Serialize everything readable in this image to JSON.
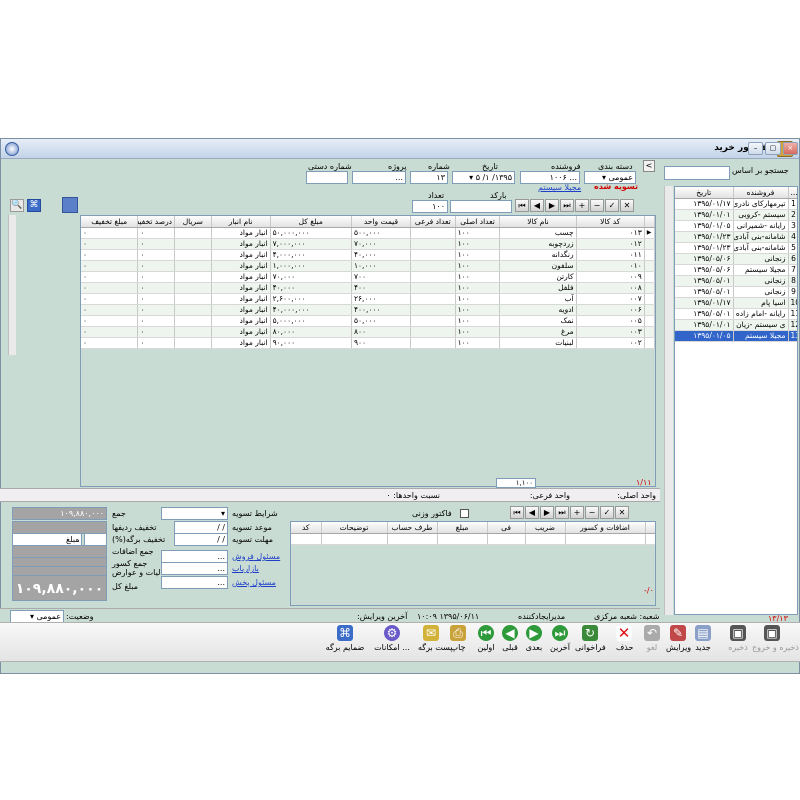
{
  "window": {
    "title": "فاکتور خرید"
  },
  "search": {
    "label": "جستجو بر اساس",
    "value": ""
  },
  "left_list": {
    "headers": [
      "...",
      "فروشنده",
      "تاریخ"
    ],
    "rows": [
      [
        "1",
        "تیرمهارکای نادری",
        "۱۳۹۵/۰۱/۱۷"
      ],
      [
        "2",
        "سیستم -کروبی",
        "۱۳۹۵/۰۱/۰۱"
      ],
      [
        "3",
        "رایانه -شمیرانی",
        "۱۳۹۵/۰۱/۰۵"
      ],
      [
        "4",
        "شامانه-بنی آبادی",
        "۱۳۹۵/۰۱/۲۳"
      ],
      [
        "5",
        "شامانه-بنی آبادی",
        "۱۳۹۵/۰۱/۲۳"
      ],
      [
        "6",
        "زنجانی",
        "۱۳۹۵/۰۵/۰۶"
      ],
      [
        "7",
        "مجیلا سیستم",
        "۱۳۹۵/۰۵/۰۶"
      ],
      [
        "8",
        "زنجانی",
        "۱۳۹۵/۰۵/۰۱"
      ],
      [
        "9",
        "زنجانی",
        "۱۳۹۵/۰۵/۰۱"
      ],
      [
        "10",
        "اسیا پام",
        "۱۳۹۵/۰۱/۱۷"
      ],
      [
        "11",
        "رایانه -امام زاده",
        "۱۳۹۵/۰۵/۰۱"
      ],
      [
        "12",
        "ی سیستم -زیان",
        "۱۳۹۵/۰۱/۰۱"
      ],
      [
        "13",
        "مجیلا سیستم",
        "۱۳۹۵/۰۱/۰۵"
      ]
    ],
    "footer": "۱۳/۱۳"
  },
  "header_fields": {
    "category_label": "دسته بندی",
    "category_value": "عمومی",
    "seller_label": "فروشنده",
    "seller_value": "... ۱۰۰۶",
    "date_label": "تاریخ",
    "date_value": "۱۳۹۵/ ۱/ ۵",
    "number_label": "شماره",
    "number_value": "۱۳",
    "project_label": "پروژه",
    "project_value": "...",
    "manual_label": "شماره دستی",
    "manual_value": "",
    "seller_link": "مجیلا سیستم",
    "settled": "تسویه شده",
    "barcode_label": "بارکد",
    "barcode_value": "",
    "count_label": "تعداد",
    "count_value": "۱۰۰"
  },
  "items_grid": {
    "headers": [
      "کد کالا",
      "نام کالا",
      "تعداد اصلی",
      "تعداد فرعی",
      "قیمت واحد",
      "مبلغ کل",
      "نام انبار",
      "سریال",
      "درصد تخفیف",
      "مبلغ تخفیف"
    ],
    "rows": [
      [
        "۰۱۳",
        "چسب",
        "۱۰۰",
        "",
        "۵۰۰,۰۰۰",
        "۵۰,۰۰۰,۰۰۰",
        "انبار مواد",
        "",
        "۰",
        "۰"
      ],
      [
        "۰۱۲",
        "زردچوبه",
        "۱۰۰",
        "",
        "۷۰,۰۰۰",
        "۷,۰۰۰,۰۰۰",
        "انبار مواد",
        "",
        "۰",
        "۰"
      ],
      [
        "۰۱۱",
        "رنگدانه",
        "۱۰۰",
        "",
        "۴۰,۰۰۰",
        "۴,۰۰۰,۰۰۰",
        "انبار مواد",
        "",
        "۰",
        "۰"
      ],
      [
        "۰۱۰",
        "سلفون",
        "۱۰۰",
        "",
        "۱۰,۰۰۰",
        "۱,۰۰۰,۰۰۰",
        "انبار مواد",
        "",
        "۰",
        "۰"
      ],
      [
        "۰۰۹",
        "کارتن",
        "۱۰۰",
        "",
        "۷۰۰",
        "۷۰,۰۰۰",
        "انبار مواد",
        "",
        "۰",
        "۰"
      ],
      [
        "۰۰۸",
        "فلفل",
        "۱۰۰",
        "",
        "۴۰۰",
        "۴۰,۰۰۰",
        "انبار مواد",
        "",
        "۰",
        "۰"
      ],
      [
        "۰۰۷",
        "آب",
        "۱۰۰",
        "",
        "۲۶,۰۰۰",
        "۲,۶۰۰,۰۰۰",
        "انبار مواد",
        "",
        "۰",
        "۰"
      ],
      [
        "۰۰۶",
        "ادویه",
        "۱۰۰",
        "",
        "۴۰۰,۰۰۰",
        "۴۰,۰۰۰,۰۰۰",
        "انبار مواد",
        "",
        "۰",
        "۰"
      ],
      [
        "۰۰۵",
        "نمک",
        "۱۰۰",
        "",
        "۵۰,۰۰۰",
        "۵,۰۰۰,۰۰۰",
        "انبار مواد",
        "",
        "۰",
        "۰"
      ],
      [
        "۰۰۳",
        "مرغ",
        "۱۰۰",
        "",
        "۸۰۰",
        "۸۰,۰۰۰",
        "انبار مواد",
        "",
        "۰",
        "۰"
      ],
      [
        "۰۰۲",
        "لبنیات",
        "۱۰۰",
        "",
        "۹۰۰",
        "۹۰,۰۰۰",
        "انبار مواد",
        "",
        "۰",
        "۰"
      ]
    ],
    "footer_count": "۱/۱۱",
    "footer_total": "۱,۱۰۰"
  },
  "units": {
    "main": "واحد اصلی:",
    "sub": "واحد فرعی:",
    "ratio": "نسبت واحدها: ۰"
  },
  "totals": {
    "sum_label": "جمع",
    "sum_value": "۱۰۹,۸۸۰,۰۰۰",
    "row_discount_label": "تخفیف ردیفها",
    "row_discount_value": "",
    "sheet_discount_label": "تخفیف برگه(%)",
    "sheet_discount_amount_label": "مبلغ",
    "sheet_discount_value": "۰",
    "additions_label": "جمع اضافات",
    "deductions_label": "جمع کسور",
    "tax_label": "مالیات و عوارض",
    "total_label": "مبلغ کل",
    "total_value": "۱۰۹,۸۸۰,۰۰۰"
  },
  "terms": {
    "settle_label": "شرایط تسویه",
    "due_label": "موعد تسویه",
    "due_value": "/  /",
    "grace_label": "مهلت تسویه",
    "grace_value": "/  /",
    "sales_resp": "مسئول فروش",
    "marketer": "بازاریاب",
    "dist_resp": "مسئول پخش"
  },
  "additions_grid": {
    "weight_invoice": "فاکتور وزنی",
    "headers": [
      "اضافات و کسور",
      "ضریب",
      "فی",
      "مبلغ",
      "طرف حساب",
      "توضیحات",
      "کد"
    ],
    "footer": "۰/-"
  },
  "status": {
    "status_label": "وضعیت:",
    "status_value": "عمومی",
    "edit_label": "آخرین ویرایش:",
    "edit_value": "۱۳۹۵/۰۶/۱۱ ۱۰:۰۹",
    "creator_label": "ایجادکننده",
    "creator_value": "مدیر",
    "branch": "شعبه: شعبه مرکزی"
  },
  "toolbar": {
    "save_exit": "ذخیره و خروج",
    "save": "ذخیره",
    "new": "جدید",
    "edit": "ویرایش",
    "undo": "لغو",
    "delete": "حذف",
    "recall": "فراخوانی",
    "last": "آخرین",
    "next": "بعدی",
    "prev": "قبلی",
    "first": "اولین",
    "print": "چاپ",
    "postsheet": "پست برگه",
    "features": "امکانات ...",
    "attach": "ضمایم برگه"
  }
}
